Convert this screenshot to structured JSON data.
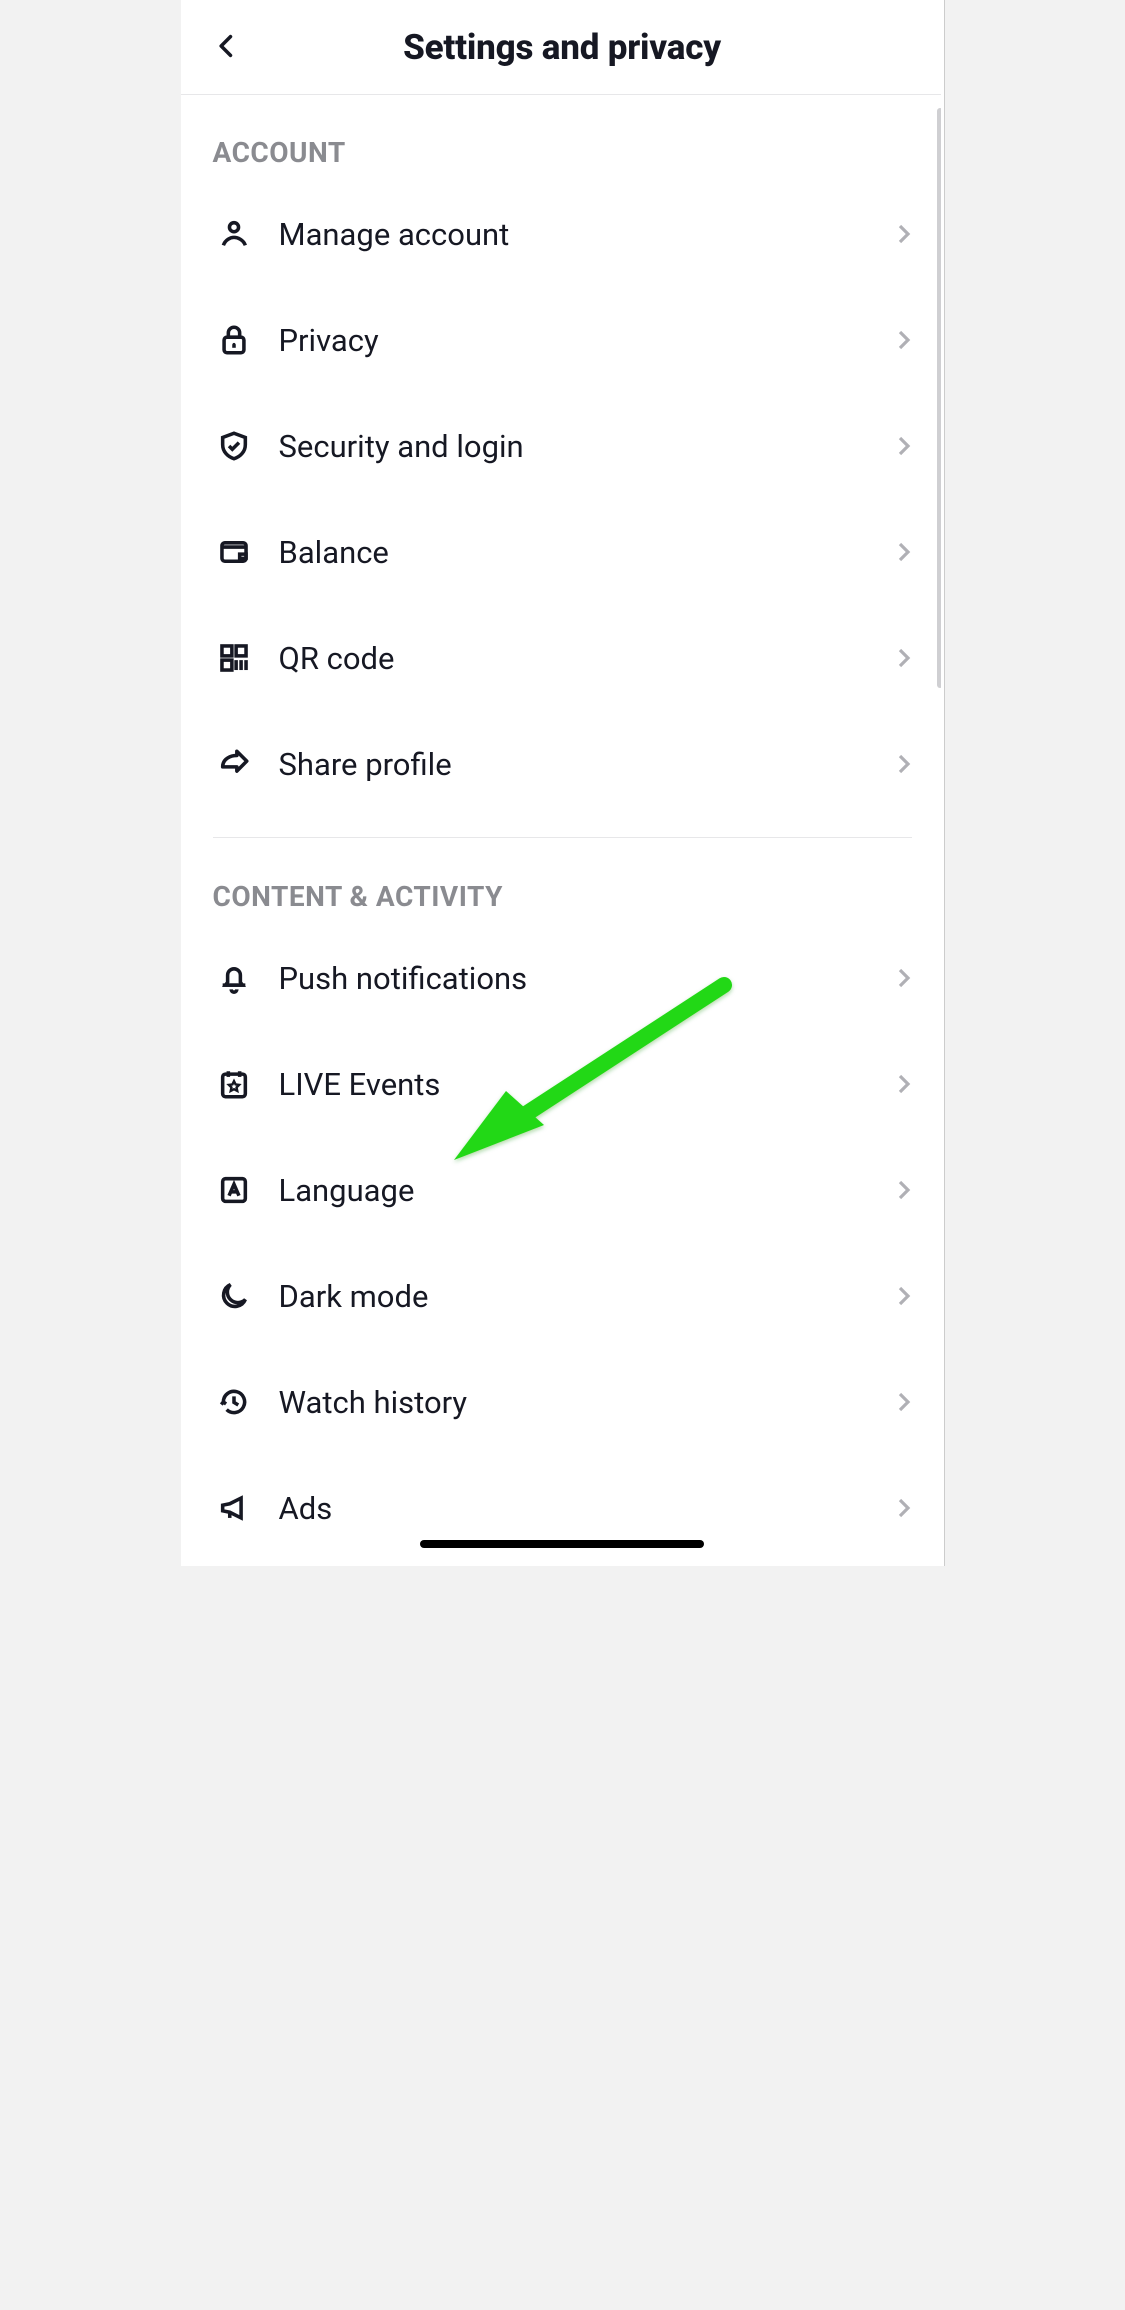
{
  "header": {
    "title": "Settings and privacy"
  },
  "sections": {
    "account": {
      "title": "ACCOUNT",
      "items": [
        {
          "label": "Manage account"
        },
        {
          "label": "Privacy"
        },
        {
          "label": "Security and login"
        },
        {
          "label": "Balance"
        },
        {
          "label": "QR code"
        },
        {
          "label": "Share profile"
        }
      ]
    },
    "content_activity": {
      "title": "CONTENT & ACTIVITY",
      "items": [
        {
          "label": "Push notifications"
        },
        {
          "label": "LIVE Events"
        },
        {
          "label": "Language"
        },
        {
          "label": "Dark mode"
        },
        {
          "label": "Watch history"
        },
        {
          "label": "Ads"
        }
      ]
    }
  },
  "annotation": {
    "target_item": "Language",
    "arrow_color": "#22d813"
  }
}
